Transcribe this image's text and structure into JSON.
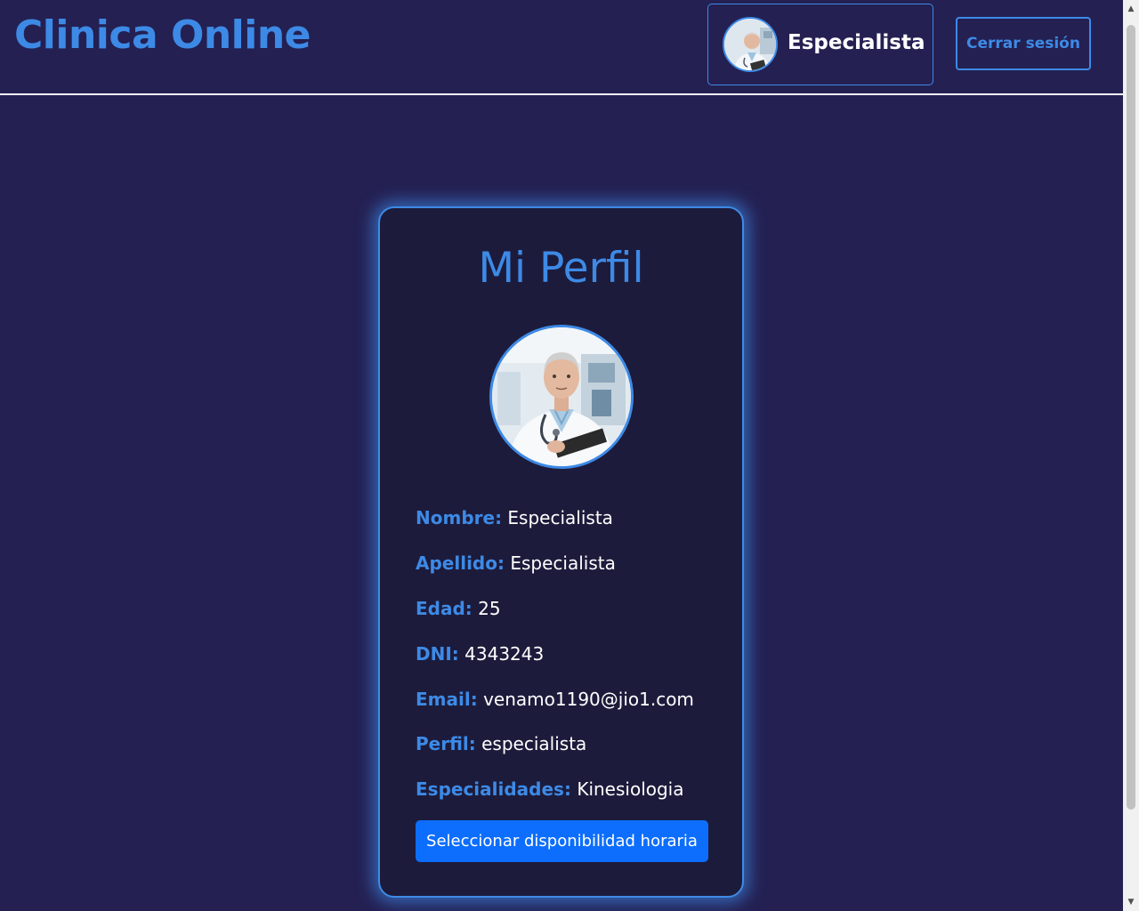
{
  "header": {
    "brand": "Clinica Online",
    "user_role": "Especialista",
    "logout_label": "Cerrar sesión"
  },
  "profile": {
    "title": "Mi Perfil",
    "fields": [
      {
        "label": "Nombre:",
        "value": "Especialista"
      },
      {
        "label": "Apellido:",
        "value": "Especialista"
      },
      {
        "label": "Edad:",
        "value": "25"
      },
      {
        "label": "DNI:",
        "value": "4343243"
      },
      {
        "label": "Email:",
        "value": "venamo1190@jio1.com"
      },
      {
        "label": "Perfil:",
        "value": "especialista"
      },
      {
        "label": "Especialidades:",
        "value": "Kinesiologia"
      }
    ],
    "availability_button": "Seleccionar disponibilidad horaria"
  },
  "colors": {
    "background": "#242052",
    "card_background": "#1d1b3b",
    "accent": "#3d8ae6",
    "primary_button": "#0d6efd"
  },
  "icons": {
    "scroll_up": "triangle-up-icon",
    "scroll_down": "triangle-down-icon"
  }
}
